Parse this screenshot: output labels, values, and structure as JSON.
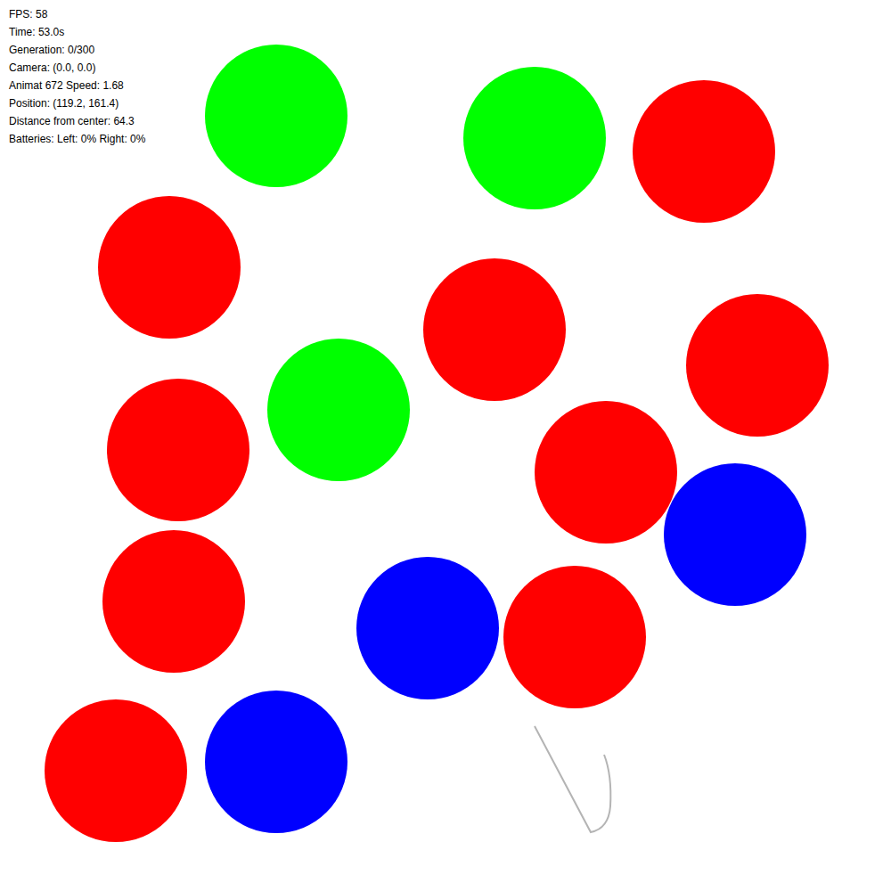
{
  "hud": {
    "lines": [
      "FPS: 58",
      "Time: 53.0s",
      "Generation: 0/300",
      "Camera: (0.0, 0.0)",
      "Animat 672 Speed: 1.68",
      "Position: (119.2, 161.4)",
      "Distance from center: 64.3",
      "Batteries: Left: 0% Right: 0%"
    ]
  },
  "objects": [
    {
      "color": "#00ff00"
    },
    {
      "color": "#00ff00"
    },
    {
      "color": "#ff0000"
    },
    {
      "color": "#ff0000"
    },
    {
      "color": "#ff0000"
    },
    {
      "color": "#ff0000"
    },
    {
      "color": "#ff0000"
    },
    {
      "color": "#00ff00"
    },
    {
      "color": "#ff0000"
    },
    {
      "color": "#0000ff"
    },
    {
      "color": "#ff0000"
    },
    {
      "color": "#0000ff"
    },
    {
      "color": "#ff0000"
    },
    {
      "color": "#ff0000"
    },
    {
      "color": "#0000ff"
    }
  ]
}
